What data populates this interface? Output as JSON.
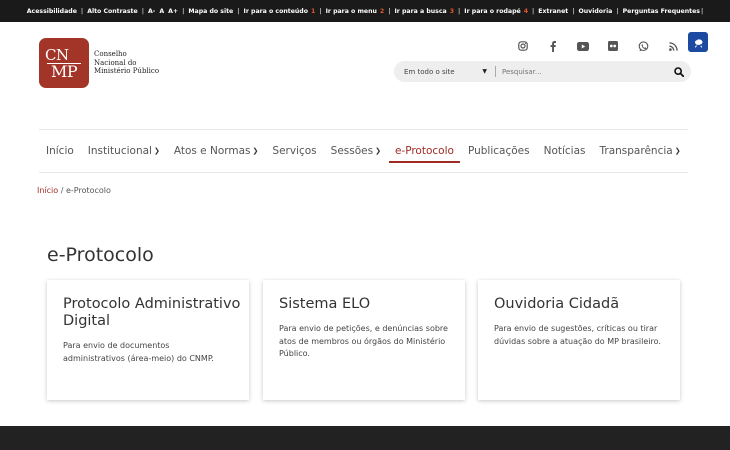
{
  "topbar": {
    "items": [
      {
        "label": "Acessibilidade",
        "num": ""
      },
      {
        "label": "Alto Contraste",
        "num": ""
      },
      {
        "label": "A-",
        "num": ""
      },
      {
        "label": "A",
        "num": ""
      },
      {
        "label": "A+",
        "num": ""
      },
      {
        "label": "Mapa do site",
        "num": ""
      },
      {
        "label": "Ir para o conteúdo",
        "num": "1"
      },
      {
        "label": "Ir para o menu",
        "num": "2"
      },
      {
        "label": "Ir para a busca",
        "num": "3"
      },
      {
        "label": "Ir para o rodapé",
        "num": "4"
      },
      {
        "label": "Extranet",
        "num": ""
      },
      {
        "label": "Ouvidoria",
        "num": ""
      },
      {
        "label": "Perguntas Frequentes",
        "num": ""
      }
    ]
  },
  "logo": {
    "letters_top": "CN",
    "letters_bottom": "MP",
    "line1": "Conselho",
    "line2": "Nacional do",
    "line3": "Ministério Público"
  },
  "socials": [
    "instagram-icon",
    "facebook-icon",
    "youtube-icon",
    "flickr-icon",
    "whatsapp-icon",
    "rss-icon"
  ],
  "search": {
    "scope": "Em todo o site",
    "placeholder": "Pesquisar..."
  },
  "nav": {
    "items": [
      {
        "label": "Início",
        "dropdown": false
      },
      {
        "label": "Institucional",
        "dropdown": true
      },
      {
        "label": "Atos e Normas",
        "dropdown": true
      },
      {
        "label": "Serviços",
        "dropdown": false
      },
      {
        "label": "Sessões",
        "dropdown": true
      },
      {
        "label": "e-Protocolo",
        "dropdown": false
      },
      {
        "label": "Publicações",
        "dropdown": false
      },
      {
        "label": "Notícias",
        "dropdown": false
      },
      {
        "label": "Transparência",
        "dropdown": true
      }
    ],
    "active": "e-Protocolo"
  },
  "breadcrumb": {
    "home": "Início",
    "separator": "/",
    "current": "e-Protocolo"
  },
  "page_title": "e-Protocolo",
  "cards": [
    {
      "title": "Protocolo Administrativo Digital",
      "desc": "Para envio de documentos administrativos (área-meio) do CNMP."
    },
    {
      "title": "Sistema ELO",
      "desc": "Para envio de petições, e denúncias sobre atos de membros ou órgãos do Ministério Público."
    },
    {
      "title": "Ouvidoria Cidadã",
      "desc": "Para envio de sugestões, críticas ou tirar dúvidas sobre a atuação do MP brasileiro."
    }
  ],
  "colors": {
    "brand": "#a23428",
    "accent_number": "#e2592a",
    "accessibility_badge": "#1c4aa1"
  }
}
